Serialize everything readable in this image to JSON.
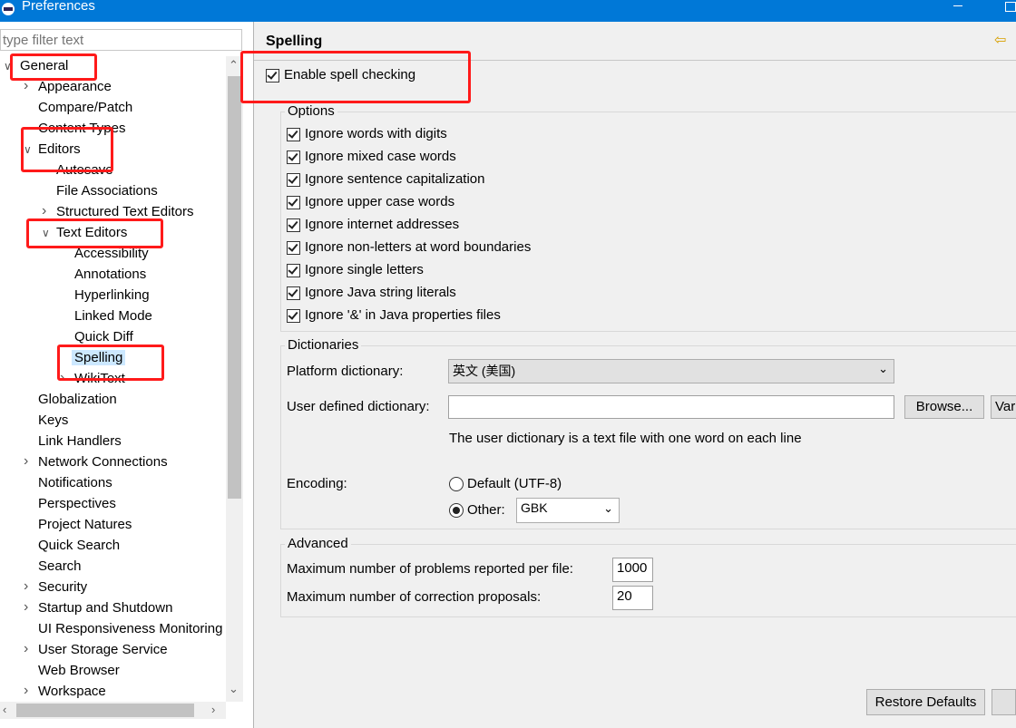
{
  "window": {
    "title": "Preferences"
  },
  "filter": {
    "placeholder": "type filter text"
  },
  "tree": [
    {
      "label": "General",
      "indent": 0,
      "twisty": "open"
    },
    {
      "label": "Appearance",
      "indent": 1,
      "twisty": "closed"
    },
    {
      "label": "Compare/Patch",
      "indent": 1,
      "twisty": ""
    },
    {
      "label": "Content Types",
      "indent": 1,
      "twisty": ""
    },
    {
      "label": "Editors",
      "indent": 1,
      "twisty": "open"
    },
    {
      "label": "Autosave",
      "indent": 2,
      "twisty": ""
    },
    {
      "label": "File Associations",
      "indent": 2,
      "twisty": ""
    },
    {
      "label": "Structured Text Editors",
      "indent": 2,
      "twisty": "closed"
    },
    {
      "label": "Text Editors",
      "indent": 2,
      "twisty": "open"
    },
    {
      "label": "Accessibility",
      "indent": 3,
      "twisty": ""
    },
    {
      "label": "Annotations",
      "indent": 3,
      "twisty": ""
    },
    {
      "label": "Hyperlinking",
      "indent": 3,
      "twisty": ""
    },
    {
      "label": "Linked Mode",
      "indent": 3,
      "twisty": ""
    },
    {
      "label": "Quick Diff",
      "indent": 3,
      "twisty": ""
    },
    {
      "label": "Spelling",
      "indent": 3,
      "twisty": "",
      "selected": true
    },
    {
      "label": "WikiText",
      "indent": 3,
      "twisty": "closed"
    },
    {
      "label": "Globalization",
      "indent": 1,
      "twisty": ""
    },
    {
      "label": "Keys",
      "indent": 1,
      "twisty": ""
    },
    {
      "label": "Link Handlers",
      "indent": 1,
      "twisty": ""
    },
    {
      "label": "Network Connections",
      "indent": 1,
      "twisty": "closed"
    },
    {
      "label": "Notifications",
      "indent": 1,
      "twisty": ""
    },
    {
      "label": "Perspectives",
      "indent": 1,
      "twisty": ""
    },
    {
      "label": "Project Natures",
      "indent": 1,
      "twisty": ""
    },
    {
      "label": "Quick Search",
      "indent": 1,
      "twisty": ""
    },
    {
      "label": "Search",
      "indent": 1,
      "twisty": ""
    },
    {
      "label": "Security",
      "indent": 1,
      "twisty": "closed"
    },
    {
      "label": "Startup and Shutdown",
      "indent": 1,
      "twisty": "closed"
    },
    {
      "label": "UI Responsiveness Monitoring",
      "indent": 1,
      "twisty": ""
    },
    {
      "label": "User Storage Service",
      "indent": 1,
      "twisty": "closed"
    },
    {
      "label": "Web Browser",
      "indent": 1,
      "twisty": ""
    },
    {
      "label": "Workspace",
      "indent": 1,
      "twisty": "closed"
    }
  ],
  "page": {
    "title": "Spelling",
    "enable": {
      "label": "Enable spell checking",
      "checked": true
    },
    "options": {
      "title": "Options",
      "items": [
        {
          "label": "Ignore words with digits",
          "checked": true
        },
        {
          "label": "Ignore mixed case words",
          "checked": true
        },
        {
          "label": "Ignore sentence capitalization",
          "checked": true
        },
        {
          "label": "Ignore upper case words",
          "checked": true
        },
        {
          "label": "Ignore internet addresses",
          "checked": true
        },
        {
          "label": "Ignore non-letters at word boundaries",
          "checked": true
        },
        {
          "label": "Ignore single letters",
          "checked": true
        },
        {
          "label": "Ignore Java string literals",
          "checked": true
        },
        {
          "label": "Ignore '&' in Java properties files",
          "checked": true
        }
      ]
    },
    "dictionaries": {
      "title": "Dictionaries",
      "platform_label": "Platform dictionary:",
      "platform_value": "英文 (美国)",
      "user_label": "User defined dictionary:",
      "user_value": "",
      "browse": "Browse...",
      "variables": "Variables...",
      "hint": "The user dictionary is a text file with one word on each line",
      "encoding_label": "Encoding:",
      "default_label": "Default (UTF-8)",
      "other_label": "Other:",
      "other_value": "GBK",
      "encoding_selected": "other"
    },
    "advanced": {
      "title": "Advanced",
      "max_problems_label": "Maximum number of problems reported per file:",
      "max_problems_value": "1000",
      "max_proposals_label": "Maximum number of correction proposals:",
      "max_proposals_value": "20"
    },
    "restore": "Restore Defaults"
  }
}
